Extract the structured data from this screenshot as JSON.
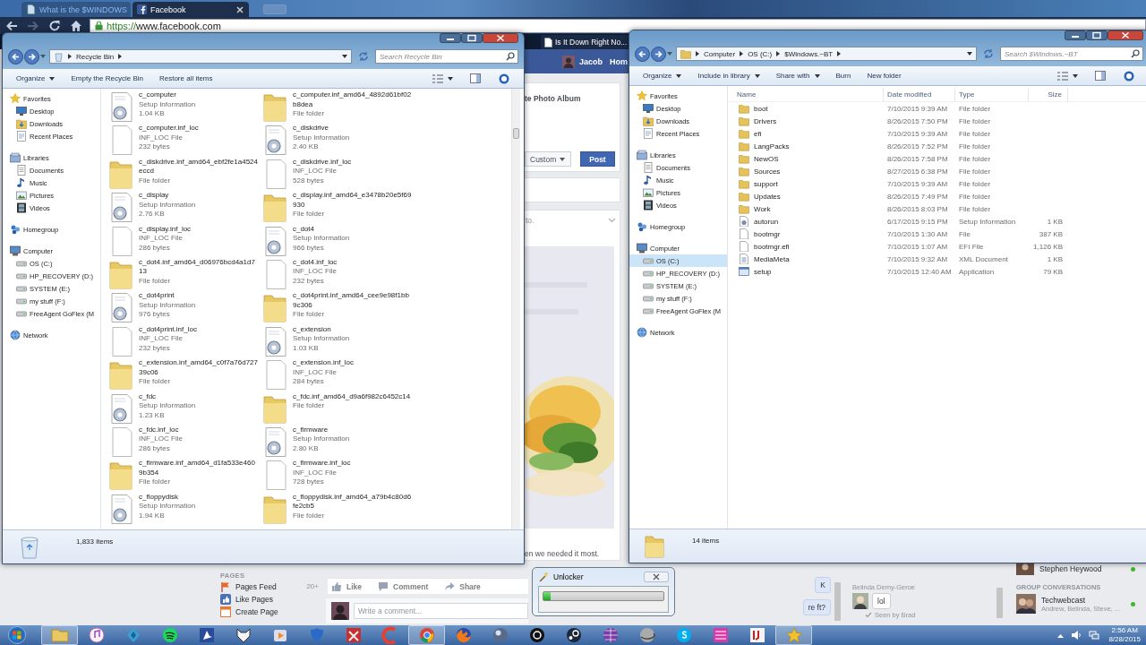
{
  "browser": {
    "tabs": [
      {
        "title": "What is the $WINDOWS",
        "selected": false
      },
      {
        "title": "Facebook",
        "selected": true
      }
    ],
    "url": "https://www.facebook.com",
    "bookmark": "Is It Down Right No..."
  },
  "facebook": {
    "user": "Jacob",
    "nav_item": "Hom",
    "album_link": "te Photo Album",
    "audience": "Custom",
    "post_button": "Post",
    "post_text": "to.",
    "post_caption": "en we needed it most.",
    "pages_heading": "PAGES",
    "pages": [
      {
        "label": "Pages Feed",
        "count": "20+"
      },
      {
        "label": "Like Pages"
      },
      {
        "label": "Create Page"
      }
    ],
    "actions": [
      "Like",
      "Comment",
      "Share"
    ],
    "comment_placeholder": "Write a comment...",
    "chat_messages": [
      "K",
      "re ft?"
    ],
    "chat_thread": {
      "sender": "Belinda Demy-Geroe",
      "message": "lol",
      "seen": "Seen by Brad"
    },
    "contacts": [
      {
        "name": "Stephen Heywood"
      }
    ],
    "group_heading": "GROUP CONVERSATIONS",
    "groups": [
      {
        "name": "Techwebcast",
        "members": "Andrew, Belinda, Steve, ..."
      }
    ]
  },
  "recycle_window": {
    "path": [
      "Recycle Bin"
    ],
    "search_placeholder": "Search Recycle Bin",
    "toolbar": [
      {
        "label": "Organize",
        "menu": true
      },
      {
        "label": "Empty the Recycle Bin",
        "menu": false
      },
      {
        "label": "Restore all items",
        "menu": false
      }
    ],
    "sidebar": [
      {
        "label": "Favorites",
        "kind": "star",
        "selected": false,
        "children": [
          {
            "label": "Desktop",
            "kind": "desktop",
            "selected": false
          },
          {
            "label": "Downloads",
            "kind": "downloads",
            "selected": false
          },
          {
            "label": "Recent Places",
            "kind": "recent",
            "selected": false
          }
        ]
      },
      {
        "label": "Libraries",
        "kind": "library",
        "selected": false,
        "children": [
          {
            "label": "Documents",
            "kind": "documents",
            "selected": false
          },
          {
            "label": "Music",
            "kind": "music",
            "selected": false
          },
          {
            "label": "Pictures",
            "kind": "pictures",
            "selected": false
          },
          {
            "label": "Videos",
            "kind": "videos",
            "selected": false
          }
        ]
      },
      {
        "label": "Homegroup",
        "kind": "homegroup",
        "selected": false
      },
      {
        "label": "Computer",
        "kind": "computer",
        "selected": false,
        "children": [
          {
            "label": "OS (C:)",
            "kind": "drive",
            "selected": false
          },
          {
            "label": "HP_RECOVERY (D:)",
            "kind": "drive",
            "selected": false
          },
          {
            "label": "SYSTEM (E:)",
            "kind": "drive",
            "selected": false
          },
          {
            "label": "my stuff (F:)",
            "kind": "drive",
            "selected": false
          },
          {
            "label": "FreeAgent GoFlex (M",
            "kind": "drive",
            "selected": false
          }
        ]
      },
      {
        "label": "Network",
        "kind": "network",
        "selected": false
      }
    ],
    "files": [
      {
        "kind": "setup",
        "name": "c_computer",
        "type": "Setup Information",
        "size": "1.04 KB"
      },
      {
        "kind": "folder",
        "name": "c_computer.inf_amd64_4892d61bf02b8dea",
        "type": "File folder"
      },
      {
        "kind": "file",
        "name": "c_computer.inf_loc",
        "type": "INF_LOC File",
        "size": "232 bytes"
      },
      {
        "kind": "setup",
        "name": "c_diskdrive",
        "type": "Setup Information",
        "size": "2.40 KB"
      },
      {
        "kind": "folder",
        "name": "c_diskdrive.inf_amd64_ebf2fe1a4524eccd",
        "type": "File folder"
      },
      {
        "kind": "file",
        "name": "c_diskdrive.inf_loc",
        "type": "INF_LOC File",
        "size": "528 bytes"
      },
      {
        "kind": "setup",
        "name": "c_display",
        "type": "Setup Information",
        "size": "2.76 KB"
      },
      {
        "kind": "folder",
        "name": "c_display.inf_amd64_e3478b20e5f69930",
        "type": "File folder"
      },
      {
        "kind": "file",
        "name": "c_display.inf_loc",
        "type": "INF_LOC File",
        "size": "286 bytes"
      },
      {
        "kind": "setup",
        "name": "c_dot4",
        "type": "Setup Information",
        "size": "966 bytes"
      },
      {
        "kind": "folder",
        "name": "c_dot4.inf_amd64_d06976bcd4a1d713",
        "type": "File folder"
      },
      {
        "kind": "file",
        "name": "c_dot4.inf_loc",
        "type": "INF_LOC File",
        "size": "232 bytes"
      },
      {
        "kind": "setup",
        "name": "c_dot4print",
        "type": "Setup Information",
        "size": "976 bytes"
      },
      {
        "kind": "folder",
        "name": "c_dot4print.inf_amd64_cee9e98f1bb9c306",
        "type": "File folder"
      },
      {
        "kind": "file",
        "name": "c_dot4print.inf_loc",
        "type": "INF_LOC File",
        "size": "232 bytes"
      },
      {
        "kind": "setup",
        "name": "c_extension",
        "type": "Setup Information",
        "size": "1.03 KB"
      },
      {
        "kind": "folder",
        "name": "c_extension.inf_amd64_c0f7a76d72739c06",
        "type": "File folder"
      },
      {
        "kind": "file",
        "name": "c_extension.inf_loc",
        "type": "INF_LOC File",
        "size": "284 bytes"
      },
      {
        "kind": "setup",
        "name": "c_fdc",
        "type": "Setup Information",
        "size": "1.23 KB"
      },
      {
        "kind": "folder",
        "name": "c_fdc.inf_amd64_d9a6f982c6452c14",
        "type": "File folder"
      },
      {
        "kind": "file",
        "name": "c_fdc.inf_loc",
        "type": "INF_LOC File",
        "size": "286 bytes"
      },
      {
        "kind": "setup",
        "name": "c_firmware",
        "type": "Setup Information",
        "size": "2.80 KB"
      },
      {
        "kind": "folder",
        "name": "c_firmware.inf_amd64_d1fa533e4609b354",
        "type": "File folder"
      },
      {
        "kind": "file",
        "name": "c_firmware.inf_loc",
        "type": "INF_LOC File",
        "size": "728 bytes"
      },
      {
        "kind": "setup",
        "name": "c_floppydisk",
        "type": "Setup Information",
        "size": "1.94 KB"
      },
      {
        "kind": "folder",
        "name": "c_floppydisk.inf_amd64_a79b4c80d6fe2cb5",
        "type": "File folder"
      }
    ],
    "status": "1,833 items"
  },
  "bt_window": {
    "path": [
      "Computer",
      "OS (C:)",
      "$Windows.~BT"
    ],
    "search_placeholder": "Search $Windows.~BT",
    "toolbar": [
      {
        "label": "Organize",
        "menu": true
      },
      {
        "label": "Include in library",
        "menu": true
      },
      {
        "label": "Share with",
        "menu": true
      },
      {
        "label": "Burn",
        "menu": false
      },
      {
        "label": "New folder",
        "menu": false
      }
    ],
    "columns": [
      "Name",
      "Date modified",
      "Type",
      "Size"
    ],
    "sidebar": [
      {
        "label": "Favorites",
        "kind": "star",
        "selected": false,
        "children": [
          {
            "label": "Desktop",
            "kind": "desktop",
            "selected": false
          },
          {
            "label": "Downloads",
            "kind": "downloads",
            "selected": false
          },
          {
            "label": "Recent Places",
            "kind": "recent",
            "selected": false
          }
        ]
      },
      {
        "label": "Libraries",
        "kind": "library",
        "selected": false,
        "children": [
          {
            "label": "Documents",
            "kind": "documents",
            "selected": false
          },
          {
            "label": "Music",
            "kind": "music",
            "selected": false
          },
          {
            "label": "Pictures",
            "kind": "pictures",
            "selected": false
          },
          {
            "label": "Videos",
            "kind": "videos",
            "selected": false
          }
        ]
      },
      {
        "label": "Homegroup",
        "kind": "homegroup",
        "selected": false
      },
      {
        "label": "Computer",
        "kind": "computer",
        "selected": false,
        "children": [
          {
            "label": "OS (C:)",
            "kind": "drive",
            "selected": true
          },
          {
            "label": "HP_RECOVERY (D:)",
            "kind": "drive",
            "selected": false
          },
          {
            "label": "SYSTEM (E:)",
            "kind": "drive",
            "selected": false
          },
          {
            "label": "my stuff (F:)",
            "kind": "drive",
            "selected": false
          },
          {
            "label": "FreeAgent GoFlex (M",
            "kind": "drive",
            "selected": false
          }
        ]
      },
      {
        "label": "Network",
        "kind": "network",
        "selected": false
      }
    ],
    "rows": [
      {
        "kind": "folder",
        "name": "boot",
        "date": "7/10/2015 9:39 AM",
        "type": "File folder",
        "selected": false
      },
      {
        "kind": "folder",
        "name": "Drivers",
        "date": "8/26/2015 7:50 PM",
        "type": "File folder",
        "selected": false
      },
      {
        "kind": "folder",
        "name": "efi",
        "date": "7/10/2015 9:39 AM",
        "type": "File folder",
        "selected": false
      },
      {
        "kind": "folder",
        "name": "LangPacks",
        "date": "8/26/2015 7:52 PM",
        "type": "File folder",
        "selected": false
      },
      {
        "kind": "folder",
        "name": "NewOS",
        "date": "8/26/2015 7:58 PM",
        "type": "File folder",
        "selected": false
      },
      {
        "kind": "folder",
        "name": "Sources",
        "date": "8/27/2015 6:38 PM",
        "type": "File folder",
        "selected": false
      },
      {
        "kind": "folder",
        "name": "support",
        "date": "7/10/2015 9:39 AM",
        "type": "File folder",
        "selected": false
      },
      {
        "kind": "folder",
        "name": "Updates",
        "date": "8/26/2015 7:49 PM",
        "type": "File folder",
        "selected": false
      },
      {
        "kind": "folder",
        "name": "Work",
        "date": "8/26/2015 8:03 PM",
        "type": "File folder",
        "selected": false
      },
      {
        "kind": "setup",
        "name": "autorun",
        "date": "6/17/2015 9:15 PM",
        "type": "Setup Information",
        "size": "1 KB",
        "selected": false
      },
      {
        "kind": "file",
        "name": "bootmgr",
        "date": "7/10/2015 1:30 AM",
        "type": "File",
        "size": "387 KB",
        "selected": false
      },
      {
        "kind": "file",
        "name": "bootmgr.efi",
        "date": "7/10/2015 1:07 AM",
        "type": "EFI File",
        "size": "1,126 KB",
        "selected": false
      },
      {
        "kind": "xml",
        "name": "MediaMeta",
        "date": "7/10/2015 9:32 AM",
        "type": "XML Document",
        "size": "1 KB",
        "selected": false
      },
      {
        "kind": "app",
        "name": "setup",
        "date": "7/10/2015 12:40 AM",
        "type": "Application",
        "size": "79 KB",
        "selected": false
      }
    ],
    "status": "14 items"
  },
  "unlocker": {
    "title": "Unlocker",
    "level": 0.06
  },
  "clock": {
    "time": "2:56 AM",
    "date": "8/28/2015"
  }
}
